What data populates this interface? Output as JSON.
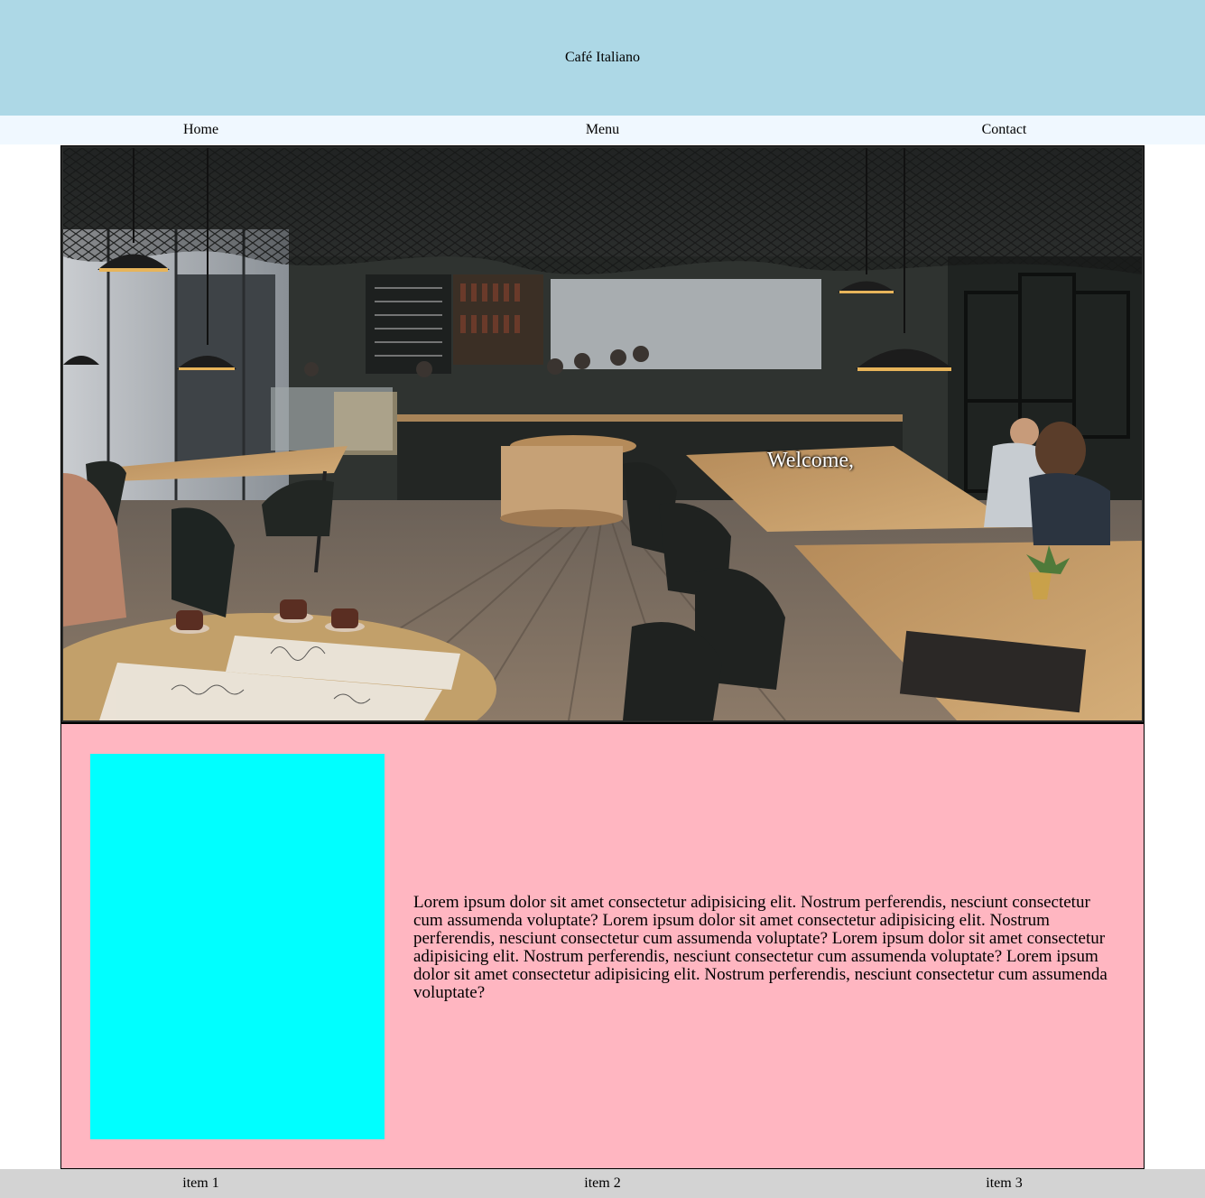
{
  "header": {
    "title": "Café Italiano"
  },
  "nav": {
    "items": [
      {
        "label": "Home"
      },
      {
        "label": "Menu"
      },
      {
        "label": "Contact"
      }
    ]
  },
  "hero": {
    "welcome": "Welcome,",
    "image": "cafe-interior-photo"
  },
  "content": {
    "paragraph": "Lorem ipsum dolor sit amet consectetur adipisicing elit. Nostrum perferendis, nesciunt consectetur cum assumenda voluptate? Lorem ipsum dolor sit amet consectetur adipisicing elit. Nostrum perferendis, nesciunt consectetur cum assumenda voluptate? Lorem ipsum dolor sit amet consectetur adipisicing elit. Nostrum perferendis, nesciunt consectetur cum assumenda voluptate? Lorem ipsum dolor sit amet consectetur adipisicing elit. Nostrum perferendis, nesciunt consectetur cum assumenda voluptate?",
    "box_color": "#00ffff",
    "background_color": "#ffb6c1"
  },
  "footer": {
    "items": [
      {
        "label": "item 1"
      },
      {
        "label": "item 2"
      },
      {
        "label": "item 3"
      }
    ]
  },
  "colors": {
    "header_bg": "#add8e6",
    "nav_bg": "#f0f8ff",
    "footer_bg": "#d3d3d3"
  }
}
